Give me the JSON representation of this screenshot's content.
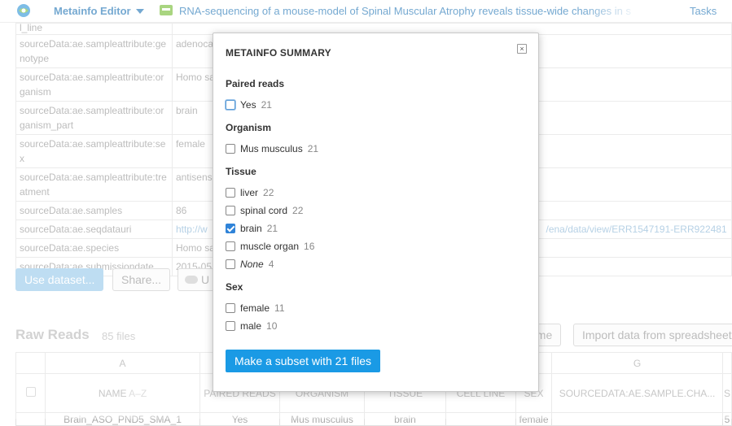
{
  "topbar": {
    "app_title": "Metainfo Editor",
    "project_title": "RNA-sequencing of a mouse-model of Spinal Muscular Atrophy reveals tissue-wide changes in s",
    "tasks_label": "Tasks"
  },
  "meta_rows": [
    {
      "key": "l_line",
      "value": ""
    },
    {
      "key": "sourceData:ae.sampleattribute:ge notype",
      "value": "adenoca"
    },
    {
      "key": "sourceData:ae.sampleattribute:or ganism",
      "value": "Homo sa"
    },
    {
      "key": "sourceData:ae.sampleattribute:or ganism_part",
      "value": "brain"
    },
    {
      "key": "sourceData:ae.sampleattribute:se x",
      "value": "female"
    },
    {
      "key": "sourceData:ae.sampleattribute:tre atment",
      "value": "antisens"
    },
    {
      "key": "sourceData:ae.samples",
      "value": "86"
    },
    {
      "key": "sourceData:ae.seqdatauri",
      "value": "http://w",
      "value_tail": "/ena/data/view/ERR1547191-ERR922481"
    },
    {
      "key": "sourceData:ae.species",
      "value": "Homo sa"
    },
    {
      "key": "sourceData:ae.submissiondate",
      "value": "2015-05"
    }
  ],
  "buttons": {
    "use_dataset": "Use dataset...",
    "share": "Share...",
    "upload_partial": "U",
    "scheme_partial": "eme",
    "import": "Import data from spreadsheet"
  },
  "raw_reads": {
    "title": "Raw Reads",
    "count": "85 files",
    "col_letters": [
      "A",
      "G"
    ],
    "headers": [
      "NAME",
      "PAIRED READS",
      "ORGANISM",
      "TISSUE",
      "CELL LINE",
      "SEX",
      "SOURCEDATA:AE.SAMPLE.CHA...",
      "S"
    ],
    "sort_hint": "A–Z",
    "first_row": [
      "Brain_ASO_PND5_SMA_1",
      "Yes",
      "Mus musculus",
      "brain",
      "",
      "female",
      "",
      "5"
    ]
  },
  "modal": {
    "title": "METAINFO SUMMARY",
    "close_glyph": "×",
    "sections": [
      {
        "title": "Paired reads",
        "options": [
          {
            "label": "Yes",
            "count": "21",
            "checked": false,
            "focus": true
          }
        ]
      },
      {
        "title": "Organism",
        "options": [
          {
            "label": "Mus musculus",
            "count": "21",
            "checked": false
          }
        ]
      },
      {
        "title": "Tissue",
        "options": [
          {
            "label": "liver",
            "count": "22",
            "checked": false
          },
          {
            "label": "spinal cord",
            "count": "22",
            "checked": false
          },
          {
            "label": "brain",
            "count": "21",
            "checked": true
          },
          {
            "label": "muscle organ",
            "count": "16",
            "checked": false
          },
          {
            "label": "None",
            "count": "4",
            "checked": false,
            "italic": true
          }
        ]
      },
      {
        "title": "Sex",
        "options": [
          {
            "label": "female",
            "count": "11",
            "checked": false
          },
          {
            "label": "male",
            "count": "10",
            "checked": false
          }
        ]
      }
    ],
    "subset_button": "Make a subset with 21 files"
  },
  "colors": {
    "accent": "#1a9ae5",
    "link": "#2a7ab8",
    "check": "#2f83d8"
  }
}
